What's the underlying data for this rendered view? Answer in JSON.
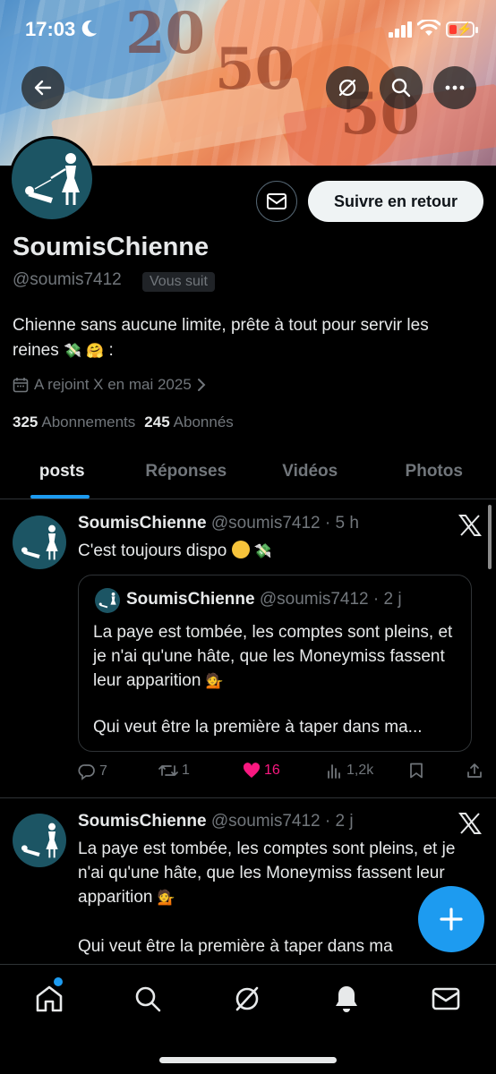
{
  "status_bar": {
    "time": "17:03"
  },
  "profile": {
    "display_name": "SoumisChienne",
    "handle": "@soumis7412",
    "follows_you_badge": "Vous suit",
    "follow_button": "Suivre en retour",
    "bio_line1": "Chienne sans aucune limite, prête à tout pour servir les",
    "bio_line2_prefix": "reines",
    "bio_line2_suffix": ":",
    "joined": "A rejoint X en mai 2025",
    "following_count": "325",
    "following_label": "Abonnements",
    "followers_count": "245",
    "followers_label": "Abonnés"
  },
  "tabs": [
    {
      "label": "posts",
      "active": true
    },
    {
      "label": "Réponses",
      "active": false
    },
    {
      "label": "Vidéos",
      "active": false
    },
    {
      "label": "Photos",
      "active": false
    }
  ],
  "tweets": [
    {
      "name": "SoumisChienne",
      "meta": "@soumis7412 · 5 h",
      "text": "C'est toujours dispo",
      "quote": {
        "name": "SoumisChienne",
        "meta": "@soumis7412 · 2 j",
        "text": "La paye est tombée, les comptes sont pleins, et je n'ai qu'une hâte, que les Moneymiss fassent leur apparition",
        "text2": "Qui veut être la première à taper dans ma..."
      },
      "replies": "7",
      "reposts": "1",
      "likes": "16",
      "views": "1,2k"
    },
    {
      "name": "SoumisChienne",
      "meta": "@soumis7412 · 2 j",
      "text": "La paye est tombée, les comptes sont pleins, et je n'ai qu'une hâte, que les Moneymiss fassent leur apparition",
      "text2": "Qui veut être la première à taper dans ma"
    }
  ],
  "icons": {
    "back": "arrow-left-icon",
    "explore": "grok-icon",
    "search": "search-icon",
    "more": "more-icon",
    "mail": "mail-icon",
    "calendar": "calendar-icon",
    "compose": "plus-icon",
    "nav": [
      "home-icon",
      "search-icon",
      "grok-icon",
      "bell-icon",
      "mail-icon"
    ]
  },
  "colors": {
    "accent": "#1d9bf0",
    "like": "#f91880",
    "muted": "#71767b"
  }
}
